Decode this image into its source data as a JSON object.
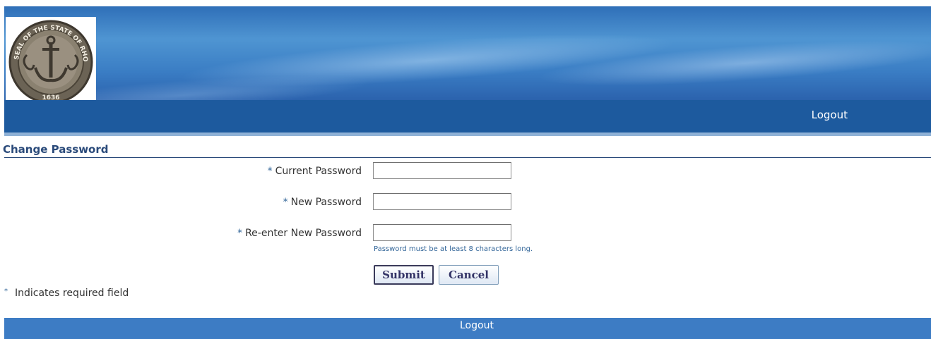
{
  "banner": {
    "seal_text": "SEAL OF THE STATE OF RHODE ISLAND AND PROVIDENCE PLANTATIONS",
    "seal_year": "1636"
  },
  "nav": {
    "logout_label": "Logout"
  },
  "section": {
    "title": "Change Password"
  },
  "form": {
    "required_marker": "*",
    "fields": [
      {
        "label": "Current Password",
        "value": ""
      },
      {
        "label": "New Password",
        "value": ""
      },
      {
        "label": "Re-enter New Password",
        "value": ""
      }
    ],
    "hint": "Password must be at least 8 characters long.",
    "submit_label": "Submit",
    "cancel_label": "Cancel"
  },
  "footnote": {
    "marker": "*",
    "text": "Indicates required field"
  },
  "footer": {
    "logout_label": "Logout"
  },
  "colors": {
    "nav_bar": "#1d5a9e",
    "footer_bar": "#3d7cc4",
    "section_title": "#2a4a7a",
    "hint_text": "#336699"
  }
}
